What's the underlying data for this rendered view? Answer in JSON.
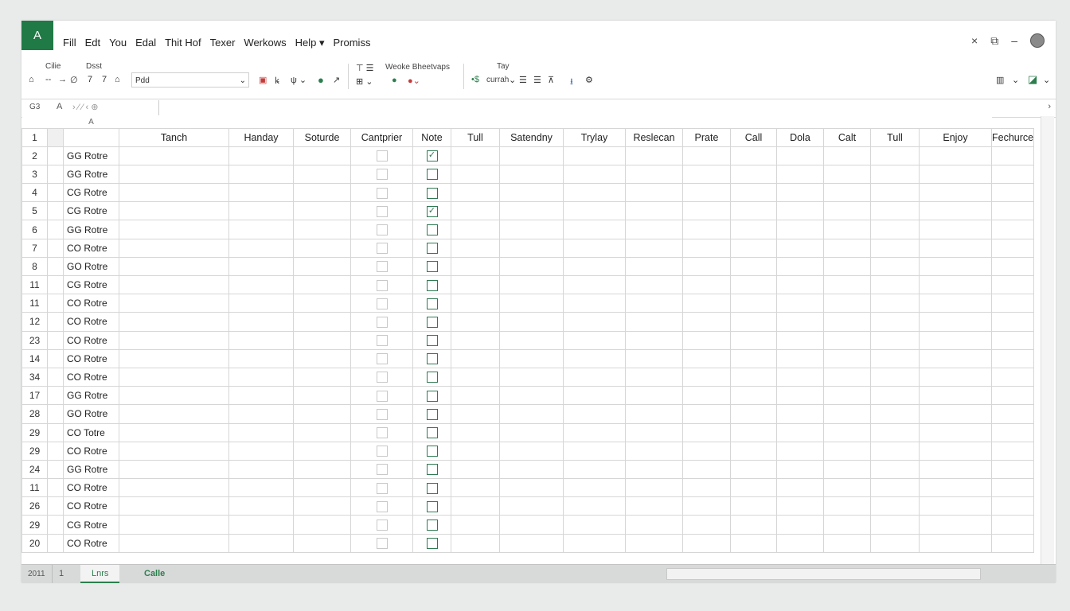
{
  "app": {
    "logo_letter": "A",
    "accent": "#1f7a45"
  },
  "menu": [
    "Fill",
    "Edt",
    "You",
    "Edal",
    "Thit Hof",
    "Texer",
    "Werkows",
    "Help ▾",
    "Promiss"
  ],
  "window_controls": {
    "close": "×",
    "restore": "⧉",
    "minimize": "–"
  },
  "ribbon": {
    "group1_label": "Cilie",
    "group2_label": "Dsst",
    "font_name": "Pdd",
    "group3_label": "Weoke Bheetvaps",
    "group4_label": "Tay",
    "currency_label": "currah",
    "misc_glyphs": [
      "⌂",
      "--",
      "→",
      "∅",
      "7",
      "7",
      "⌂"
    ]
  },
  "formula_bar": {
    "cell_ref": "G3",
    "fx": "A"
  },
  "columns": {
    "letter_row": "A",
    "headers": [
      "Tanch",
      "Handay",
      "Soturde",
      "Cantprier",
      "Note",
      "Tull",
      "Satendny",
      "Trylay",
      "Reslecan",
      "Prate",
      "Call",
      "Dola",
      "Calt",
      "Tull",
      "Enjoy",
      "Fechurce"
    ]
  },
  "rows": [
    {
      "num": "1",
      "label": "",
      "check": null
    },
    {
      "num": "2",
      "label": "GG Rotre",
      "check": true
    },
    {
      "num": "3",
      "label": "GG Rotre",
      "check": false
    },
    {
      "num": "4",
      "label": "CG Rotre",
      "check": false
    },
    {
      "num": "5",
      "label": "CG Rotre",
      "check": true
    },
    {
      "num": "6",
      "label": "GG Rotre",
      "check": false
    },
    {
      "num": "7",
      "label": "CO Rotre",
      "check": false
    },
    {
      "num": "8",
      "label": "GO Rotre",
      "check": false
    },
    {
      "num": "11",
      "label": "CG Rotre",
      "check": false
    },
    {
      "num": "11",
      "label": "CO Rotre",
      "check": false
    },
    {
      "num": "12",
      "label": "CO Rotre",
      "check": false
    },
    {
      "num": "23",
      "label": "CO Rotre",
      "check": false
    },
    {
      "num": "14",
      "label": "CO Rotre",
      "check": false
    },
    {
      "num": "34",
      "label": "CO Rotre",
      "check": false
    },
    {
      "num": "17",
      "label": "GG Rotre",
      "check": false
    },
    {
      "num": "28",
      "label": "GO Rotre",
      "check": false
    },
    {
      "num": "29",
      "label": "CO Totre",
      "check": false
    },
    {
      "num": "29",
      "label": "CO Rotre",
      "check": false
    },
    {
      "num": "24",
      "label": "GG Rotre",
      "check": false
    },
    {
      "num": "11",
      "label": "CO Rotre",
      "check": false
    },
    {
      "num": "26",
      "label": "CO Rotre",
      "check": false
    },
    {
      "num": "29",
      "label": "CG Rotre",
      "check": false
    },
    {
      "num": "20",
      "label": "CO Rotre",
      "check": false
    }
  ],
  "sheet_tabs": {
    "left_info": "2011",
    "left_num": "1",
    "tab1": "Lnrs",
    "tab2": "Calle"
  }
}
